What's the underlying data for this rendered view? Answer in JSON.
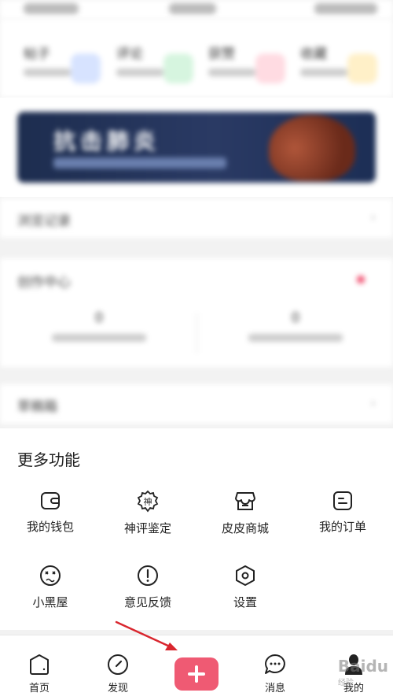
{
  "counters": [
    {
      "title": "帖子",
      "color": "#d7e3ff"
    },
    {
      "title": "评论",
      "color": "#d6f5df"
    },
    {
      "title": "获赞",
      "color": "#ffdbe2"
    },
    {
      "title": "收藏",
      "color": "#fff0c8"
    }
  ],
  "banner": {
    "title": "抗击肺炎"
  },
  "history": {
    "title": "浏览记录"
  },
  "creator": {
    "title": "创作中心",
    "stats": [
      {
        "value": "0"
      },
      {
        "value": "0"
      }
    ]
  },
  "drafts": {
    "title": "草稿箱"
  },
  "more_functions": {
    "title": "更多功能",
    "items": [
      {
        "label": "我的钱包",
        "icon": "wallet-icon"
      },
      {
        "label": "神评鉴定",
        "icon": "shen-badge-icon"
      },
      {
        "label": "皮皮商城",
        "icon": "shop-icon"
      },
      {
        "label": "我的订单",
        "icon": "order-icon"
      },
      {
        "label": "小黑屋",
        "icon": "dizzy-face-icon"
      },
      {
        "label": "意见反馈",
        "icon": "feedback-icon"
      },
      {
        "label": "设置",
        "icon": "settings-hexagon-icon"
      }
    ],
    "shen_glyph": "神"
  },
  "bottom_nav": {
    "home": "首页",
    "discover": "发现",
    "messages": "消息",
    "mine": "我的"
  },
  "watermark": {
    "text": "Baidu",
    "sub": "经验"
  },
  "colors": {
    "accent": "#ef5a73",
    "arrow": "#d9262e"
  }
}
